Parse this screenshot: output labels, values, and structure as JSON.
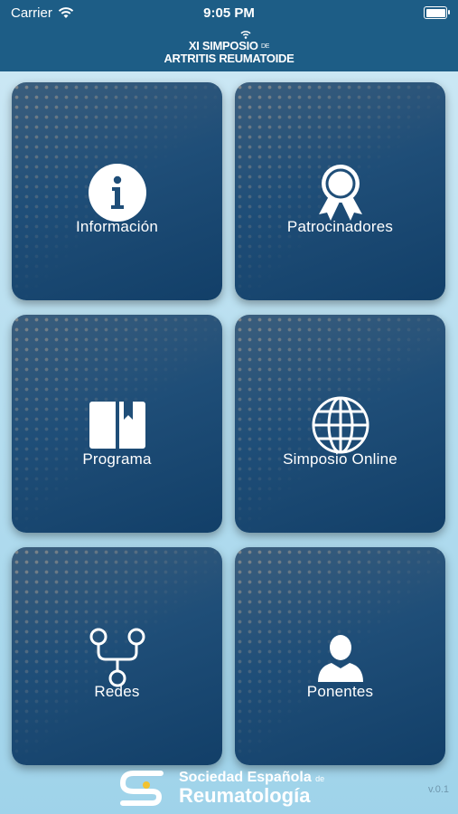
{
  "status": {
    "carrier": "Carrier",
    "time": "9:05 PM"
  },
  "header": {
    "line1": "XI SIMPOSIO",
    "line1_suffix": "DE",
    "line2": "ARTRITIS REUMATOIDE"
  },
  "tiles": [
    {
      "label": "Información",
      "icon": "info-icon"
    },
    {
      "label": "Patrocinadores",
      "icon": "award-ribbon-icon"
    },
    {
      "label": "Programa",
      "icon": "book-icon"
    },
    {
      "label": "Simposio Online",
      "icon": "globe-icon"
    },
    {
      "label": "Redes",
      "icon": "network-icon"
    },
    {
      "label": "Ponentes",
      "icon": "person-icon"
    }
  ],
  "footer": {
    "org_line1": "Sociedad Española",
    "org_line1_suffix": "de",
    "org_line2": "Reumatología",
    "version": "v.0.1"
  },
  "colors": {
    "header_bg": "#1d5d86",
    "tile_top": "#3b5e7d",
    "tile_bottom": "#123f68",
    "background": "#b8dff0"
  }
}
